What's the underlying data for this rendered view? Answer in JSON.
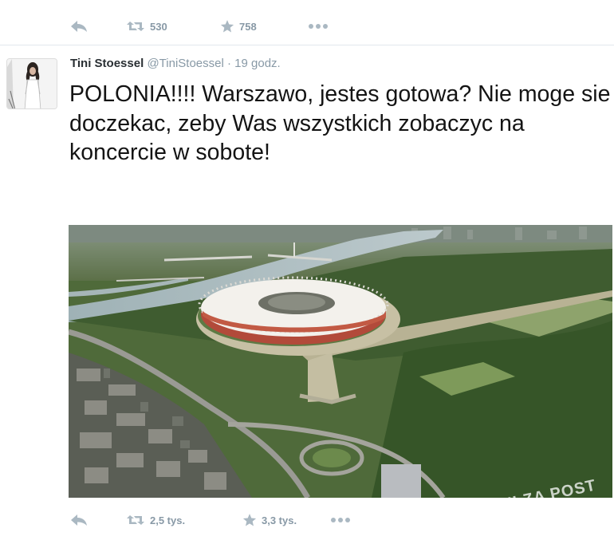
{
  "prev_tweet": {
    "actions": {
      "retweet_count": "530",
      "favorite_count": "758"
    }
  },
  "tweet": {
    "author_name": "Tini Stoessel",
    "author_handle": "@TiniStoessel",
    "separator": "·",
    "time": "19 godz.",
    "text": "POLONIA!!!! Warszawo, jestes gotowa? Nie moge sie doczekac, zeby Was wszystkich zobaczyc na koncercie w sobote!",
    "photo": {
      "watermark": "PLOTKI ZA POST"
    },
    "actions": {
      "retweet_count": "2,5 tys.",
      "favorite_count": "3,3 tys."
    }
  },
  "colors": {
    "action_gray": "#aab8c2",
    "count_gray": "#8899a6",
    "divider": "#e1e8ed",
    "text": "#141414"
  }
}
